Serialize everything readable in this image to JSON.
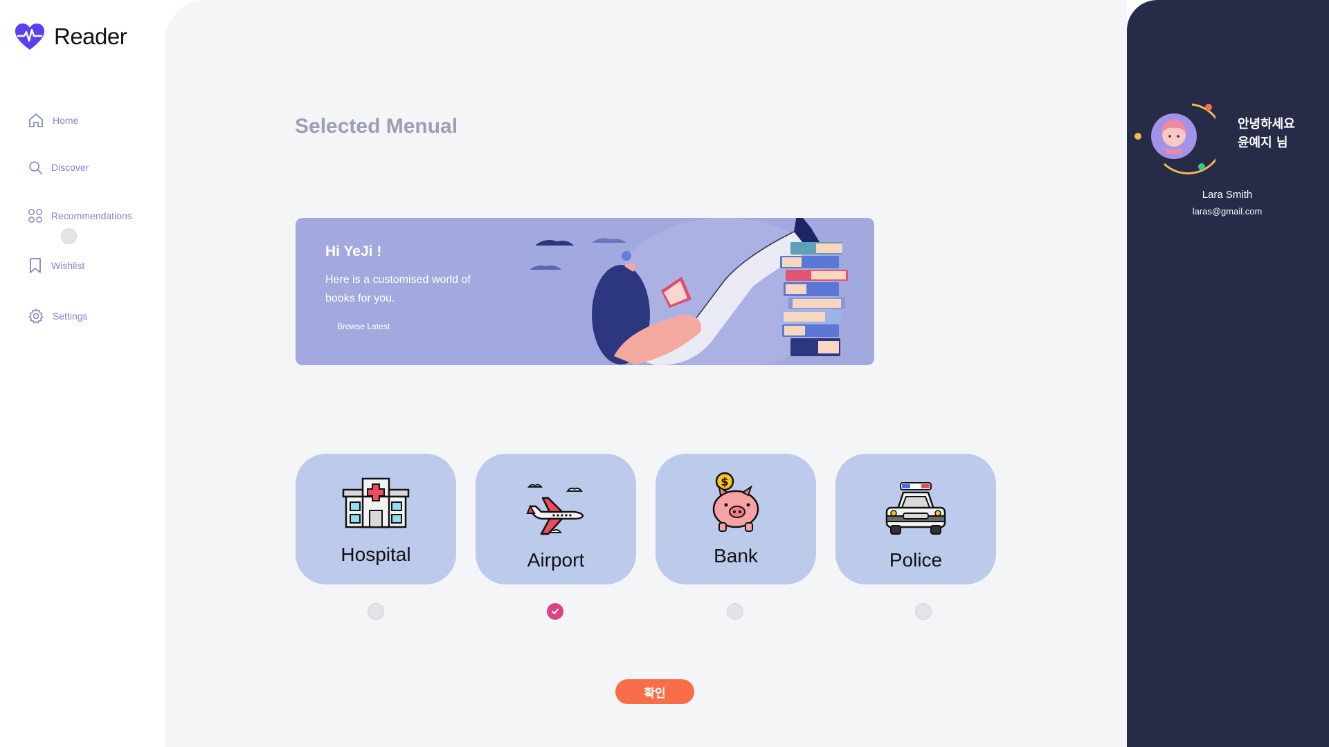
{
  "app": {
    "name": "Reader"
  },
  "sidebar": {
    "items": [
      {
        "label": "Home",
        "icon": "home-icon"
      },
      {
        "label": "Discover",
        "icon": "search-icon"
      },
      {
        "label": "Recommendations",
        "icon": "grid-icon"
      },
      {
        "label": "Wishlist",
        "icon": "bookmark-icon"
      },
      {
        "label": "Settings",
        "icon": "gear-icon"
      }
    ]
  },
  "main": {
    "title": "Selected Menual",
    "banner": {
      "greeting": "Hi YeJi !",
      "text": "Here is a customised world of books for you.",
      "button": "Browse Latest"
    },
    "options": [
      {
        "label": "Hospital",
        "icon": "hospital-icon",
        "selected": false
      },
      {
        "label": "Airport",
        "icon": "airplane-icon",
        "selected": true
      },
      {
        "label": "Bank",
        "icon": "piggy-bank-icon",
        "selected": false
      },
      {
        "label": "Police",
        "icon": "police-car-icon",
        "selected": false
      }
    ],
    "confirm_label": "확인"
  },
  "profile": {
    "greeting_line1": "안녕하세요",
    "greeting_line2": "윤예지 님",
    "name": "Lara Smith",
    "email": "laras@gmail.com"
  },
  "colors": {
    "accent": "#5b3ff5",
    "banner": "#a1a9de",
    "card": "#bccbec",
    "selected_radio": "#d94482",
    "confirm": "#f96e48",
    "panel": "#262b48"
  }
}
